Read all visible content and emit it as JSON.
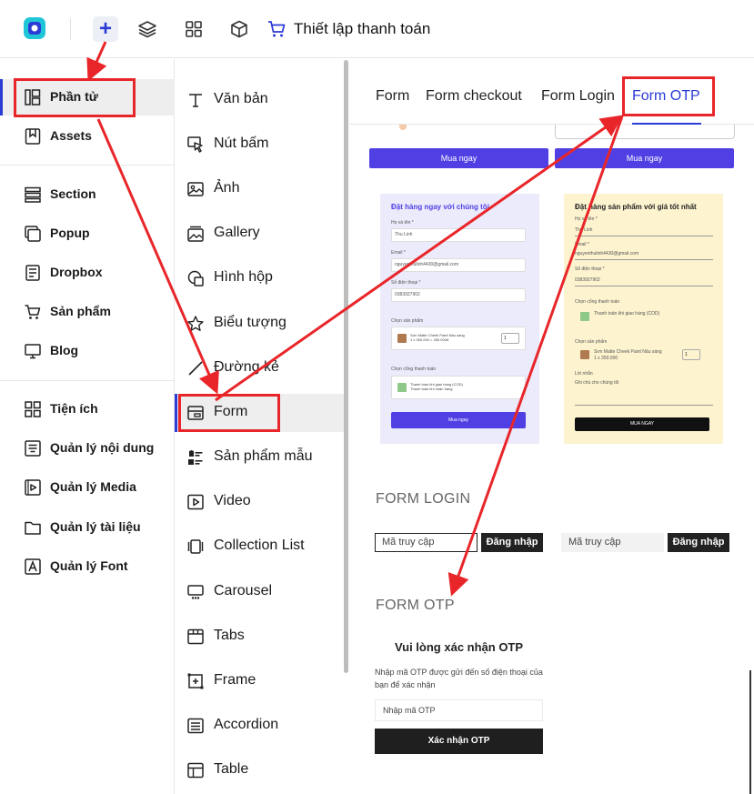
{
  "topbar": {
    "title": "Thiết lập thanh toán",
    "plus": "+",
    "icons": [
      "layers-icon",
      "grid-icon",
      "box-icon",
      "cart-icon"
    ],
    "accent": "#2b3bd6"
  },
  "sidebar": {
    "items": [
      {
        "label": "Phần tử",
        "icon": "elements-icon",
        "active": true
      },
      {
        "label": "Assets",
        "icon": "bookmark-icon"
      },
      {
        "label": "Section",
        "icon": "section-icon"
      },
      {
        "label": "Popup",
        "icon": "popup-icon"
      },
      {
        "label": "Dropbox",
        "icon": "dropbox-icon"
      },
      {
        "label": "Sản phẩm",
        "icon": "cart-icon"
      },
      {
        "label": "Blog",
        "icon": "monitor-icon"
      },
      {
        "label": "Tiện ích",
        "icon": "widgets-icon"
      },
      {
        "label": "Quản lý nội dung",
        "icon": "content-icon"
      },
      {
        "label": "Quản lý Media",
        "icon": "media-icon"
      },
      {
        "label": "Quản lý tài liệu",
        "icon": "folder-icon"
      },
      {
        "label": "Quản lý Font",
        "icon": "font-icon"
      }
    ]
  },
  "elements": {
    "items": [
      {
        "label": "Văn bản",
        "icon": "text-icon"
      },
      {
        "label": "Nút bấm",
        "icon": "cursor-icon"
      },
      {
        "label": "Ảnh",
        "icon": "image-icon"
      },
      {
        "label": "Gallery",
        "icon": "gallery-icon"
      },
      {
        "label": "Hình hộp",
        "icon": "shapes-icon"
      },
      {
        "label": "Biểu tượng",
        "icon": "star-icon"
      },
      {
        "label": "Đường kẻ",
        "icon": "line-icon"
      },
      {
        "label": "Form",
        "icon": "form-icon",
        "active": true
      },
      {
        "label": "Sản phẩm mẫu",
        "icon": "product-sample-icon"
      },
      {
        "label": "Video",
        "icon": "video-icon"
      },
      {
        "label": "Collection List",
        "icon": "collection-icon"
      },
      {
        "label": "Carousel",
        "icon": "carousel-icon"
      },
      {
        "label": "Tabs",
        "icon": "tabs-icon"
      },
      {
        "label": "Frame",
        "icon": "frame-icon"
      },
      {
        "label": "Accordion",
        "icon": "accordion-icon"
      },
      {
        "label": "Table",
        "icon": "table-icon"
      }
    ]
  },
  "preview": {
    "tabs": [
      "Form",
      "Form checkout",
      "Form Login",
      "Form OTP"
    ],
    "active_tab": "Form OTP",
    "buy_label": "Mua ngay",
    "card1": {
      "title": "Đặt hàng ngay với chúng tôi",
      "name_label": "Họ và tên *",
      "name_value": "Thu Linh",
      "email_label": "Email *",
      "email_value": "nguyenthulinh4430@gmail.com",
      "phone_label": "Số điện thoại *",
      "phone_value": "0383927902",
      "product_label": "Chọn sản phẩm",
      "product_name": "Sơn Matte Cheek Paint Nâu sáng",
      "product_price": "1 x 350.000 =  350.000đ",
      "qty": "1",
      "payment_label": "Chọn cổng thanh toán",
      "payment_name": "Thanh toán khi giao hàng (COD)",
      "payment_note": "Thanh toán khi nhận hàng",
      "submit": "Mua ngay"
    },
    "card2": {
      "title": "Đặt hàng sản phẩm với giá tốt nhất",
      "name_label": "Họ và tên *",
      "name_value": "Thu Linh",
      "email_label": "Email *",
      "email_value": "nguyenthulinh4430@gmail.com",
      "phone_label": "Số điện thoại *",
      "phone_value": "0383927902",
      "payment_label": "Chọn cổng thanh toán",
      "payment_name": "Thanh toán khi giao hàng (COD)",
      "product_label": "Chọn sản phẩm",
      "product_name": "Sơn Matte Cheek Paint Nâu sáng",
      "product_price": "1 x 350.000",
      "qty": "1",
      "note_label": "Lời nhắn",
      "note_value": "Ghi chú cho chúng tôi",
      "submit": "MUA NGAY"
    },
    "login": {
      "heading": "FORM LOGIN",
      "placeholder": "Mã truy cập",
      "button": "Đăng nhập"
    },
    "otp": {
      "heading": "FORM OTP",
      "title": "Vui lòng xác nhận OTP",
      "description": "Nhập mã OTP được gửi đến số điện thoại của bạn để xác nhận",
      "placeholder": "Nhập mã OTP",
      "button": "Xác nhận OTP"
    }
  },
  "annotation_color": "#e8262a"
}
